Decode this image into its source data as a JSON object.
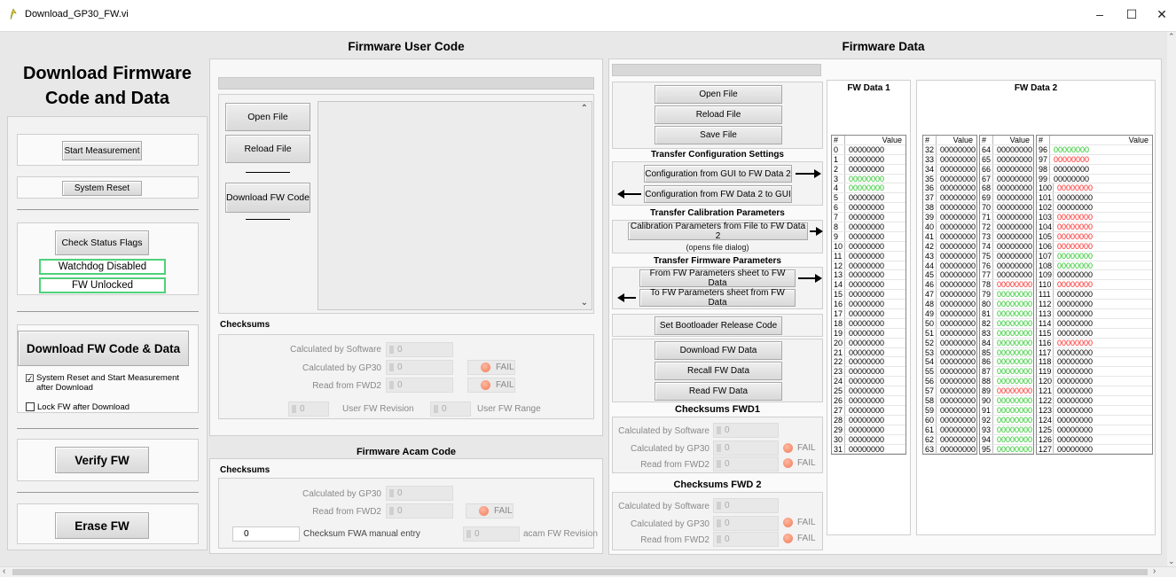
{
  "window": {
    "title": "Download_GP30_FW.vi",
    "minimize": "–",
    "maximize": "☐",
    "close": "✕"
  },
  "left": {
    "title": "Download Firmware Code and Data",
    "start_measurement": "Start Measurement",
    "system_reset": "System Reset",
    "check_status_flags": "Check Status Flags",
    "watchdog_status": "Watchdog Disabled",
    "fw_lock_status": "FW Unlocked",
    "download_fw_code_data": "Download FW Code & Data",
    "opt_reset_start": "System Reset and Start Measurement after Download",
    "opt_reset_start_checked": "☑",
    "opt_lock_fw": "Lock FW after Download",
    "verify_fw": "Verify FW",
    "erase_fw": "Erase FW"
  },
  "user_code": {
    "title": "Firmware User Code",
    "open_file": "Open File",
    "reload_file": "Reload File",
    "download_fw_code": "Download FW Code",
    "checksums_title": "Checksums",
    "calc_software_label": "Calculated by Software",
    "calc_software_value": "0",
    "calc_gp30_label": "Calculated by GP30",
    "calc_gp30_value": "0",
    "read_fwd2_label": "Read from FWD2",
    "read_fwd2_value": "0",
    "fail": "FAIL",
    "revision_value": "0",
    "revision_label": "User FW Revision",
    "range_value": "0",
    "range_label": "User FW Range"
  },
  "acam_code": {
    "title": "Firmware Acam Code",
    "checksums_title": "Checksums",
    "calc_gp30_label": "Calculated by GP30",
    "calc_gp30_value": "0",
    "read_fwd2_label": "Read from FWD2",
    "read_fwd2_value": "0",
    "fail": "FAIL",
    "manual_value": "0",
    "manual_label": "Checksum FWA manual entry",
    "revision_value": "0",
    "revision_label": "acam FW Revision"
  },
  "fw_data": {
    "title": "Firmware Data",
    "open_file": "Open File",
    "reload_file": "Reload File",
    "save_file": "Save File",
    "transfer_config_title": "Transfer Configuration Settings",
    "config_gui_to_fw2": "Configuration from GUI to FW Data 2",
    "config_fw2_to_gui": "Configuration from FW Data 2 to GUI",
    "transfer_calib_title": "Transfer Calibration Parameters",
    "calib_file_to_fw2": "Calibration Parameters from File to FW Data 2",
    "opens_file_dialog": "(opens file dialog)",
    "transfer_fw_params_title": "Transfer Firmware Parameters",
    "from_fw_params": "From FW Parameters sheet to FW Data",
    "to_fw_params": "To FW Parameters sheet from FW Data",
    "set_bootloader": "Set Bootloader Release Code",
    "download_fw_data": "Download FW Data",
    "recall_fw_data": "Recall FW Data",
    "read_fw_data": "Read FW Data",
    "checksums_fwd1_title": "Checksums FWD1",
    "checksums_fwd2_title": "Checksums FWD 2",
    "calc_software_label": "Calculated by Software",
    "calc_gp30_label": "Calculated by GP30",
    "read_fwd2_label": "Read from FWD2",
    "zero": "0",
    "fail": "FAIL"
  },
  "table": {
    "fw1_title": "FW Data 1",
    "fw2_title": "FW Data 2",
    "hash": "#",
    "value": "Value",
    "cell_value": "00000000",
    "green_rows": [
      3,
      4,
      79,
      80,
      81,
      82,
      83,
      84,
      85,
      86,
      87,
      88,
      90,
      91,
      92,
      93,
      94,
      95,
      96,
      107,
      108
    ],
    "red_rows": [
      78,
      89,
      97,
      100,
      103,
      104,
      105,
      106,
      110,
      116
    ],
    "colors": {
      "green": "#1ec41e",
      "red": "#ff2020"
    }
  }
}
